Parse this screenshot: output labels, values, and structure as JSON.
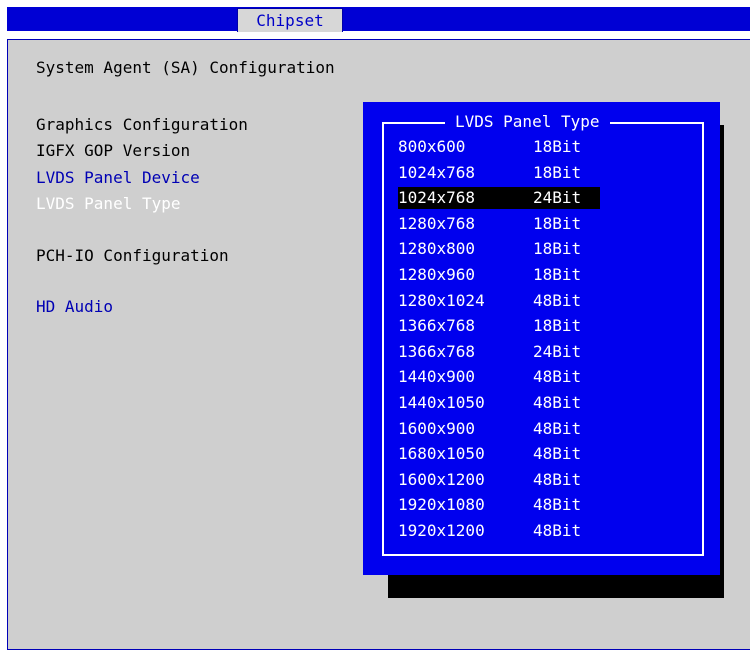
{
  "header": {
    "tab_label": "Chipset"
  },
  "main": {
    "section_title": "System Agent (SA) Configuration",
    "items": {
      "graphics_configuration": "Graphics Configuration",
      "igfx_gop_version": "IGFX GOP Version",
      "lvds_panel_device": "LVDS Panel Device",
      "lvds_panel_type": "LVDS Panel Type",
      "pch_io_configuration": "PCH-IO Configuration",
      "hd_audio": "HD Audio"
    }
  },
  "popup": {
    "title": "LVDS Panel Type",
    "selected_index": 2,
    "options": [
      {
        "resolution": "800x600",
        "bits": "18Bit"
      },
      {
        "resolution": "1024x768",
        "bits": "18Bit"
      },
      {
        "resolution": "1024x768",
        "bits": "24Bit"
      },
      {
        "resolution": "1280x768",
        "bits": "18Bit"
      },
      {
        "resolution": "1280x800",
        "bits": "18Bit"
      },
      {
        "resolution": "1280x960",
        "bits": "18Bit"
      },
      {
        "resolution": "1280x1024",
        "bits": "48Bit"
      },
      {
        "resolution": "1366x768",
        "bits": "18Bit"
      },
      {
        "resolution": "1366x768",
        "bits": "24Bit"
      },
      {
        "resolution": "1440x900",
        "bits": "48Bit"
      },
      {
        "resolution": "1440x1050",
        "bits": "48Bit"
      },
      {
        "resolution": "1600x900",
        "bits": "48Bit"
      },
      {
        "resolution": "1680x1050",
        "bits": "48Bit"
      },
      {
        "resolution": "1600x1200",
        "bits": "48Bit"
      },
      {
        "resolution": "1920x1080",
        "bits": "48Bit"
      },
      {
        "resolution": "1920x1200",
        "bits": "48Bit"
      }
    ]
  },
  "colors": {
    "menu_bar": "#0000d4",
    "panel_bg": "#cfcfcf",
    "popup_bg": "#0000ee",
    "selected_bg": "#000000",
    "link_text": "#0000b4"
  }
}
